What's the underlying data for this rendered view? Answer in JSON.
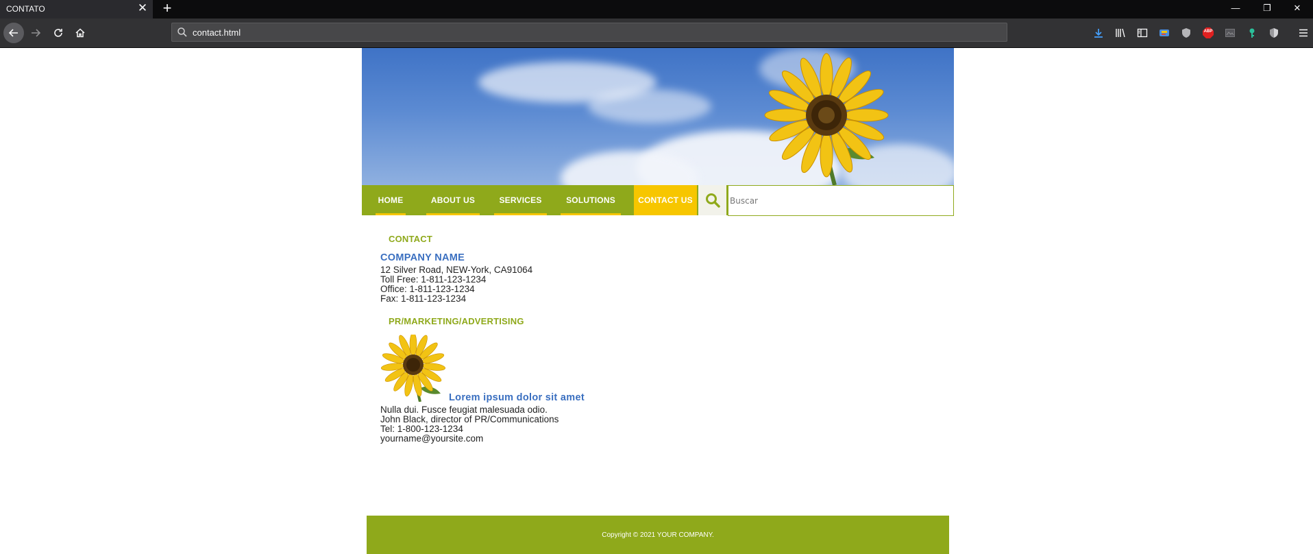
{
  "browser": {
    "tab_title": "CONTATO",
    "tab_close": "✕",
    "new_tab": "+",
    "url": "contact.html",
    "window_controls": {
      "minimize": "—",
      "restore": "❐",
      "close": "✕"
    },
    "toolbar_icons": [
      "download-icon",
      "library-icon",
      "sidebar-icon",
      "extension-icon",
      "shield-icon",
      "adblock-icon",
      "extension-icon-2",
      "key-icon",
      "shield-icon-2",
      "menu-icon"
    ],
    "adblock_label": "ABP"
  },
  "header": {
    "menu": [
      {
        "label": "HOME",
        "active": false
      },
      {
        "label": "ABOUT US",
        "active": false
      },
      {
        "label": "SERVICES",
        "active": false
      },
      {
        "label": "SOLUTIONS",
        "active": false
      },
      {
        "label": "CONTACT US",
        "active": true
      }
    ],
    "search": {
      "placeholder": "Buscar"
    }
  },
  "contact": {
    "title": "CONTACT",
    "company_name": "COMPANY NAME",
    "address": "12 Silver Road, NEW-York, CA91064",
    "toll_free": "Toll Free: 1-811-123-1234",
    "office": "Office: 1-811-123-1234",
    "fax": "Fax: 1-811-123-1234"
  },
  "pr": {
    "title": "PR/MARKETING/ADVERTISING",
    "heading": "Lorem ipsum dolor sit amet",
    "line1": "Nulla dui. Fusce feugiat malesuada odio.",
    "line2": "John Black, director of PR/Communications",
    "tel": "Tel: 1-800-123-1234",
    "email": "yourname@yoursite.com"
  },
  "footer": {
    "copyright": "Copyright © 2021 YOUR COMPANY."
  },
  "colors": {
    "accent_green": "#8fa91b",
    "accent_yellow": "#f7c600",
    "link_blue": "#3a6fc0",
    "chrome_dark": "#0c0c0d"
  }
}
